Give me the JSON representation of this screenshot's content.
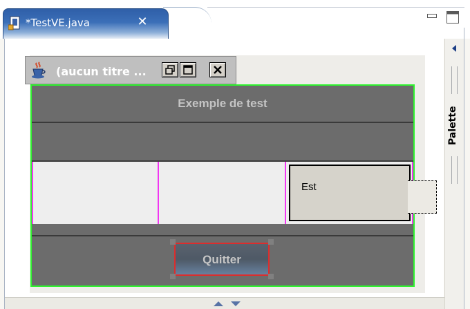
{
  "editor_tab": {
    "title": "*TestVE.java",
    "icon": "java-file-icon",
    "close_icon": "close-icon"
  },
  "view_controls": {
    "minimize_icon": "minimize-icon",
    "maximize_icon": "maximize-icon"
  },
  "jframe": {
    "title": "(aucun titre ...",
    "icon": "java-cup-icon",
    "buttons": [
      "iconify-icon",
      "maximize-icon",
      "close-icon"
    ]
  },
  "content": {
    "header_label": "Exemple de test",
    "east_label": "Est",
    "quit_button": "Quitter"
  },
  "palette": {
    "label": "Palette",
    "expand_icon": "triangle-left-icon"
  },
  "bottom_bar": {
    "icons": [
      "arrow-up-icon",
      "arrow-down-icon"
    ]
  },
  "colors": {
    "tab_active": "#3b6fb8",
    "content_bg": "#6c6c6c",
    "selection_green": "#2ef42e",
    "grid_magenta": "#f235f2",
    "button_border_red": "#dd2d2d"
  }
}
